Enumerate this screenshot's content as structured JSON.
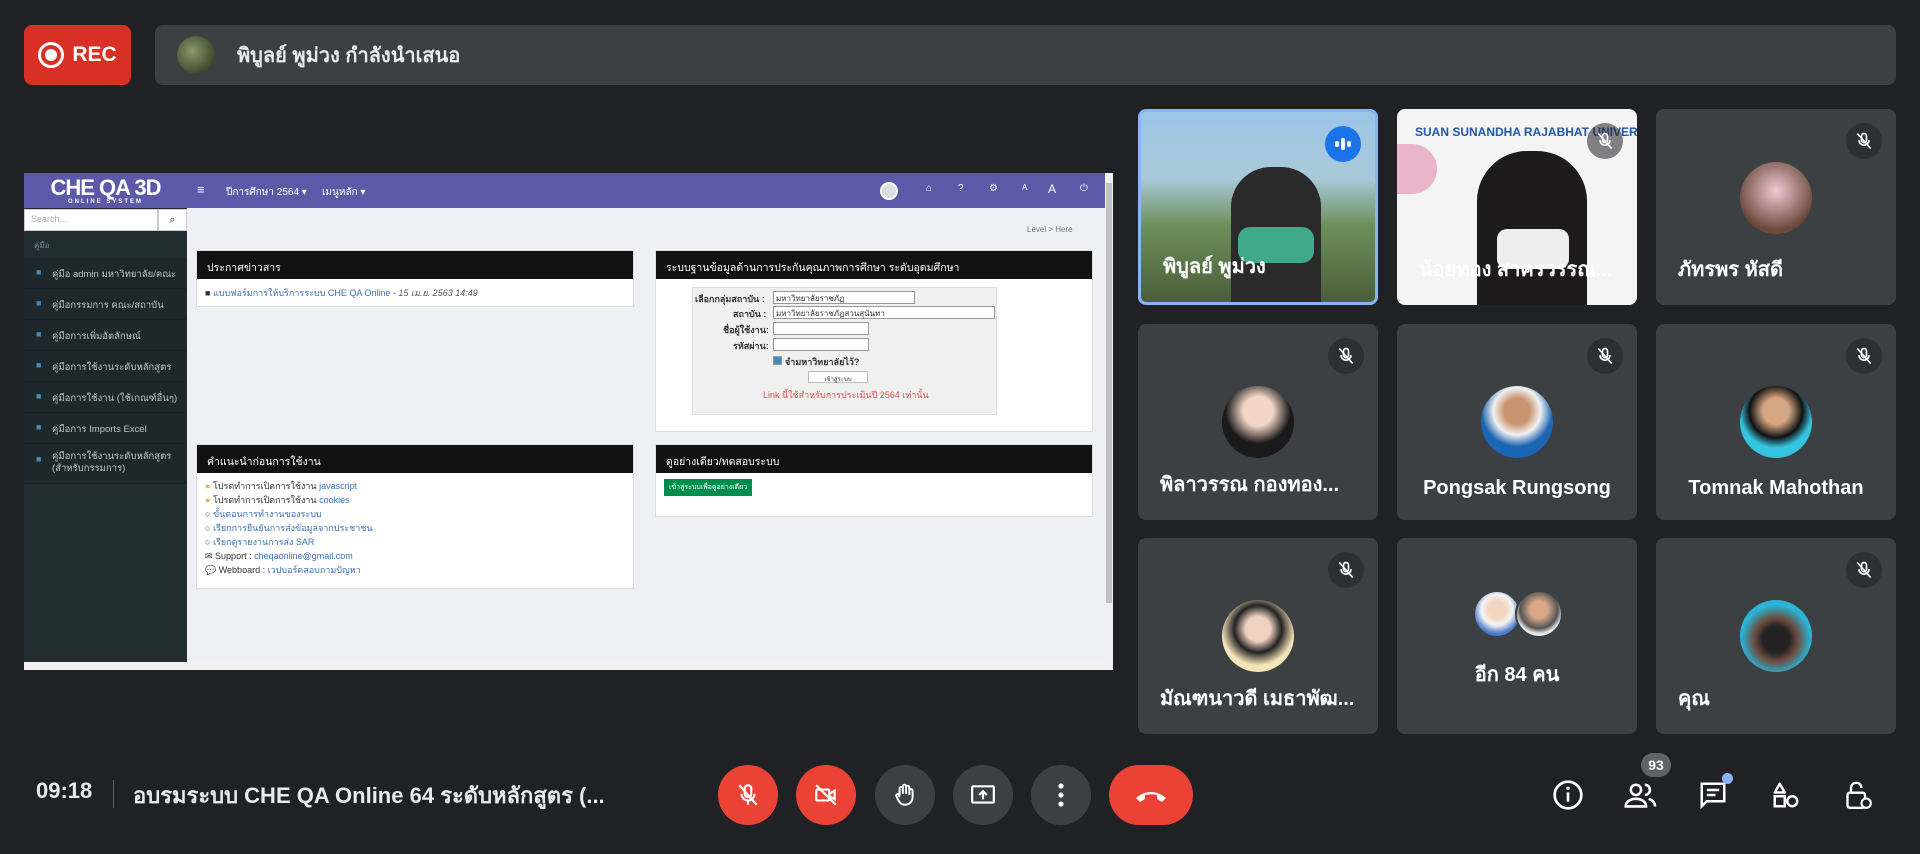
{
  "top": {
    "rec_label": "REC",
    "presenter_text": "พิบูลย์ พูม่วง กำลังนำเสนอ"
  },
  "shared_screen": {
    "logo": "CHE QA 3D",
    "logo_sub": "ONLINE SYSTEM",
    "menu_year": "ปีการศึกษา 2564 ▾",
    "menu_main": "เมนูหลัก ▾",
    "search_placeholder": "Search...",
    "sidebar_header": "คู่มือ",
    "sidebar_items": [
      "คู่มือ admin มหาวิทยาลัย/คณะ",
      "คู่มือกรรมการ คณะ/สถาบัน",
      "คู่มือการเพิ่มอัตลักษณ์",
      "คู่มือการใช้งานระดับหลักสูตร",
      "คู่มือการใช้งาน (ใช้เกณฑ์อื่นๆ)",
      "คู่มือการ Imports Excel",
      "คู่มือการใช้งานระดับหลักสูตร (สำหรับกรรมการ)"
    ],
    "breadcrumb_level": "Level",
    "breadcrumb_here": "Here",
    "news": {
      "title": "ประกาศข่าวสาร",
      "item_link": "แบบฟอร์มการให้บริการระบบ CHE QA Online",
      "item_date": " - 15 เม.ย. 2563 14:49"
    },
    "login": {
      "title": "ระบบฐานข้อมูลด้านการประกันคุณภาพการศึกษา ระดับอุดมศึกษา",
      "group_label": "เลือกกลุ่มสถาบัน :",
      "group_value": "มหาวิทยาลัยราชภัฏ",
      "inst_label": "สถาบัน :",
      "inst_value": "มหาวิทยาลัยราชภัฏสวนสุนันทา",
      "user_label": "ชื่อผู้ใช้งาน:",
      "pass_label": "รหัสผ่าน:",
      "remember_label": "จำมหาวิทยาลัยไว้?",
      "submit_label": "เข้าสู่ระบบ",
      "note": "Link นี้ใช้สำหรับการประเมินปี 2564 เท่านั้น"
    },
    "advice": {
      "title": "คำแนะนำก่อนการใช้งาน",
      "line1_prefix": "โปรดทำการเปิดการใช้งาน ",
      "line1_link": "javascript",
      "line2_prefix": "โปรดทำการเปิดการใช้งาน ",
      "line2_link": "cookies",
      "line3": "ขั้นตอนการทำงานของระบบ",
      "line4": "เรียกการยืนยันการส่งข้อมูลจากประชาชน",
      "line5": "เรียกดูรายงานการส่ง SAR",
      "support_prefix": "Support : ",
      "support_email": "cheqaonline@gmail.com",
      "webboard_prefix": "Webboard : ",
      "webboard_link": "เวปบอร์ดสอบถามปัญหา"
    },
    "demo": {
      "title": "ดูอย่างเดียว/ทดสอบระบบ",
      "button": "เข้าสู่ระบบเพื่อดูอย่างเดียว"
    }
  },
  "participants": [
    {
      "name": "พิบูลย์ พูม่วง",
      "speaking": true
    },
    {
      "name": "น้อยทอง สาครวรรณ...",
      "muted": true,
      "banner": "SUAN SUNANDHA RAJABHAT UNIVERSITY"
    },
    {
      "name": "ภัทรพร หัสดี",
      "muted": true
    },
    {
      "name": "พิลาวรรณ กองทอง...",
      "muted": true
    },
    {
      "name": "Pongsak Rungsong",
      "muted": true
    },
    {
      "name": "Tomnak Mahothan",
      "muted": true
    },
    {
      "name": "มัณฑนาวดี เมธาพัฒ...",
      "muted": true
    },
    {
      "name": "อีก 84 คน"
    },
    {
      "name": "คุณ",
      "muted": true
    }
  ],
  "bottom": {
    "time": "09:18",
    "meeting_title": "อบรมระบบ CHE QA Online 64 ระดับหลักสูตร (...",
    "participant_count": "93"
  },
  "colors": {
    "background": "#202124",
    "tile": "#3c4043",
    "danger": "#ea4335",
    "speaking_border": "#8ab4f8",
    "che_header": "#5c5aa8"
  },
  "icons": [
    "record-icon",
    "mic-off-icon",
    "camera-off-icon",
    "raise-hand-icon",
    "present-icon",
    "more-icon",
    "end-call-icon",
    "info-icon",
    "people-icon",
    "chat-icon",
    "activities-icon",
    "host-controls-icon"
  ]
}
